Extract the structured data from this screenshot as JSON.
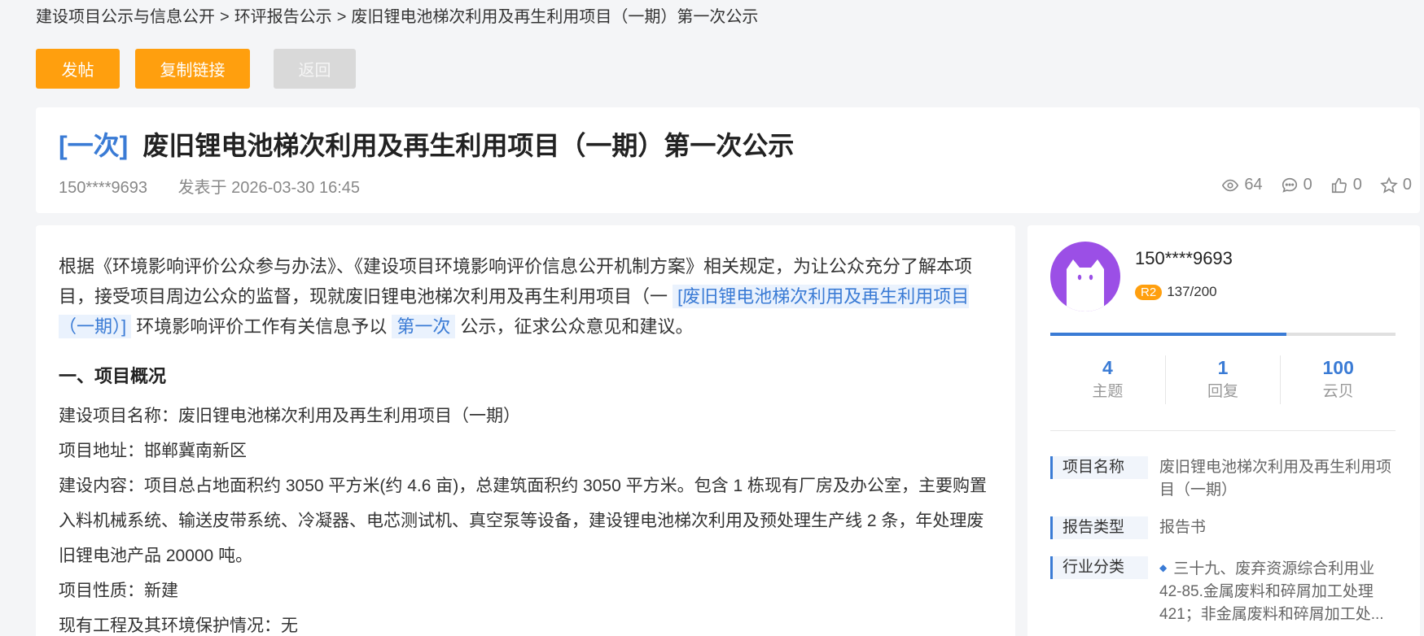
{
  "breadcrumb": {
    "items": [
      "建设项目公示与信息公开",
      "环评报告公示",
      "废旧锂电池梯次利用及再生利用项目（一期）第一次公示"
    ],
    "separator": ">"
  },
  "toolbar": {
    "post_label": "发帖",
    "copy_link_label": "复制链接",
    "back_label": "返回"
  },
  "post": {
    "tag": "[一次]",
    "title": "废旧锂电池梯次利用及再生利用项目（一期）第一次公示",
    "author": "150****9693",
    "published": "发表于 2026-03-30 16:45",
    "views": "64",
    "comments": "0",
    "likes": "0",
    "favorites": "0"
  },
  "content": {
    "intro_pre": "根据《环境影响评价公众参与办法》、《建设项目环境影响评价信息公开机制方案》相关规定，为让公众充分了解本项目，接受项目周边公众的监督，现就废旧锂电池梯次利用及再生利用项目（一",
    "intro_link1": "[废旧锂电池梯次利用及再生利用项目（一期）]",
    "intro_mid": "环境影响评价工作有关信息予以",
    "intro_link2": "第一次",
    "intro_post": "公示，征求公众意见和建议。",
    "section_title": "一、项目概况",
    "fields": [
      "建设项目名称：废旧锂电池梯次利用及再生利用项目（一期）",
      "项目地址：邯郸冀南新区",
      "建设内容：项目总占地面积约 3050 平方米(约 4.6 亩)，总建筑面积约 3050 平方米。包含 1 栋现有厂房及办公室，主要购置入料机械系统、输送皮带系统、冷凝器、电芯测试机、真空泵等设备，建设锂电池梯次利用及预处理生产线 2 条，年处理废旧锂电池产品 20000 吨。",
      "项目性质：新建",
      "现有工程及其环境保护情况：无"
    ]
  },
  "sidebar": {
    "username": "150****9693",
    "level_badge": "R2",
    "level_progress_text": "137/200",
    "level_progress_fraction": 0.685,
    "avatar_color": "#9b4fe6",
    "counts": [
      {
        "num": "4",
        "label": "主题"
      },
      {
        "num": "1",
        "label": "回复"
      },
      {
        "num": "100",
        "label": "云贝"
      }
    ],
    "info": [
      {
        "label": "项目名称",
        "value": "废旧锂电池梯次利用及再生利用项目（一期）"
      },
      {
        "label": "报告类型",
        "value": "报告书"
      },
      {
        "label": "行业分类",
        "value": "三十九、废弃资源综合利用业 42-85.金属废料和碎屑加工处理 421；非金属废料和碎屑加工处..."
      }
    ]
  },
  "colors": {
    "accent": "#3a7bd5",
    "button_orange": "#ff9f0e",
    "button_disabled": "#d9d9d9"
  }
}
